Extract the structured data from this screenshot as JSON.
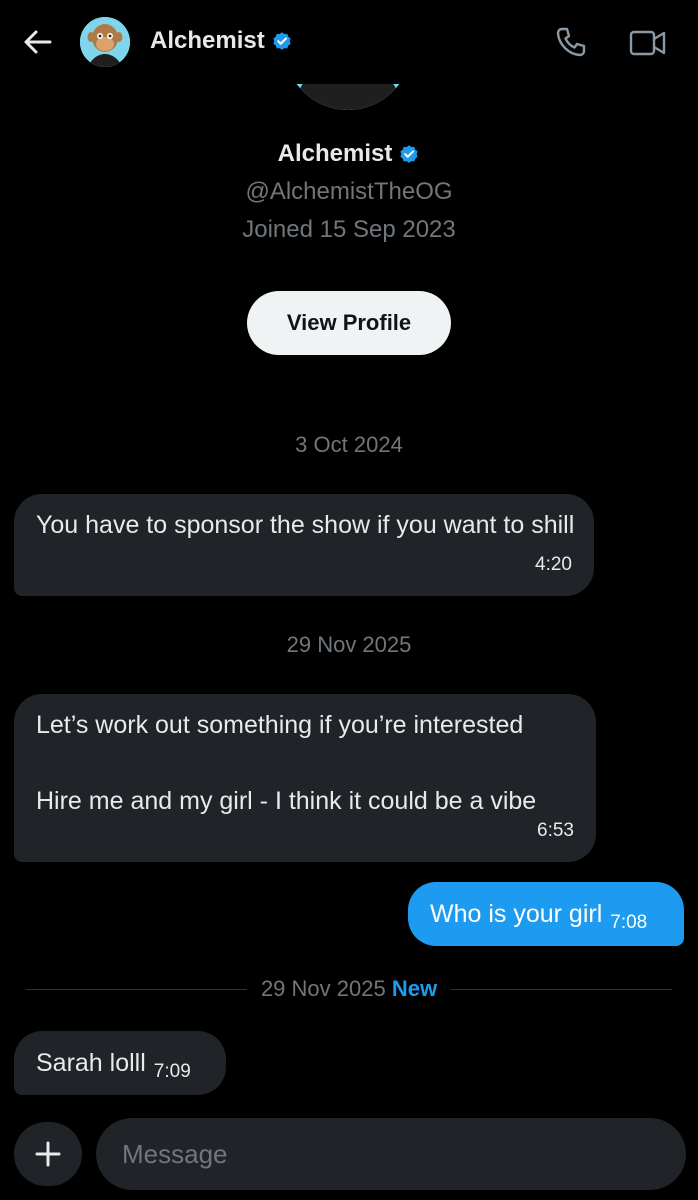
{
  "header": {
    "name": "Alchemist",
    "back_icon": "arrow-left-icon",
    "verified_icon": "verified-badge-icon",
    "call_icon": "phone-icon",
    "video_icon": "video-camera-icon"
  },
  "profile": {
    "name": "Alchemist",
    "handle": "@AlchemistTheOG",
    "joined": "Joined 15 Sep 2023",
    "view_profile_label": "View Profile"
  },
  "conversation": {
    "date_1": "3 Oct 2024",
    "date_2": "29 Nov 2025",
    "date_3": "29 Nov 2025",
    "new_label": "New",
    "messages": [
      {
        "direction": "incoming",
        "text": "You have to sponsor the show if you want to shill",
        "time": "4:20"
      },
      {
        "direction": "incoming",
        "lines": [
          "Let’s work out something if you’re interested",
          "Hire me and my girl - I think it could be a vibe"
        ],
        "time": "6:53"
      },
      {
        "direction": "outgoing",
        "text": "Who is your girl",
        "time": "7:08"
      },
      {
        "direction": "incoming",
        "text": "Sarah lolll",
        "time": "7:09"
      }
    ]
  },
  "composer": {
    "placeholder": "Message",
    "add_icon": "plus-icon"
  },
  "colors": {
    "background": "#000000",
    "incoming_bubble": "#202327",
    "outgoing_bubble": "#1d9bf0",
    "accent": "#1d9bf0",
    "muted_text": "#71767b",
    "button_light": "#eff3f4"
  }
}
